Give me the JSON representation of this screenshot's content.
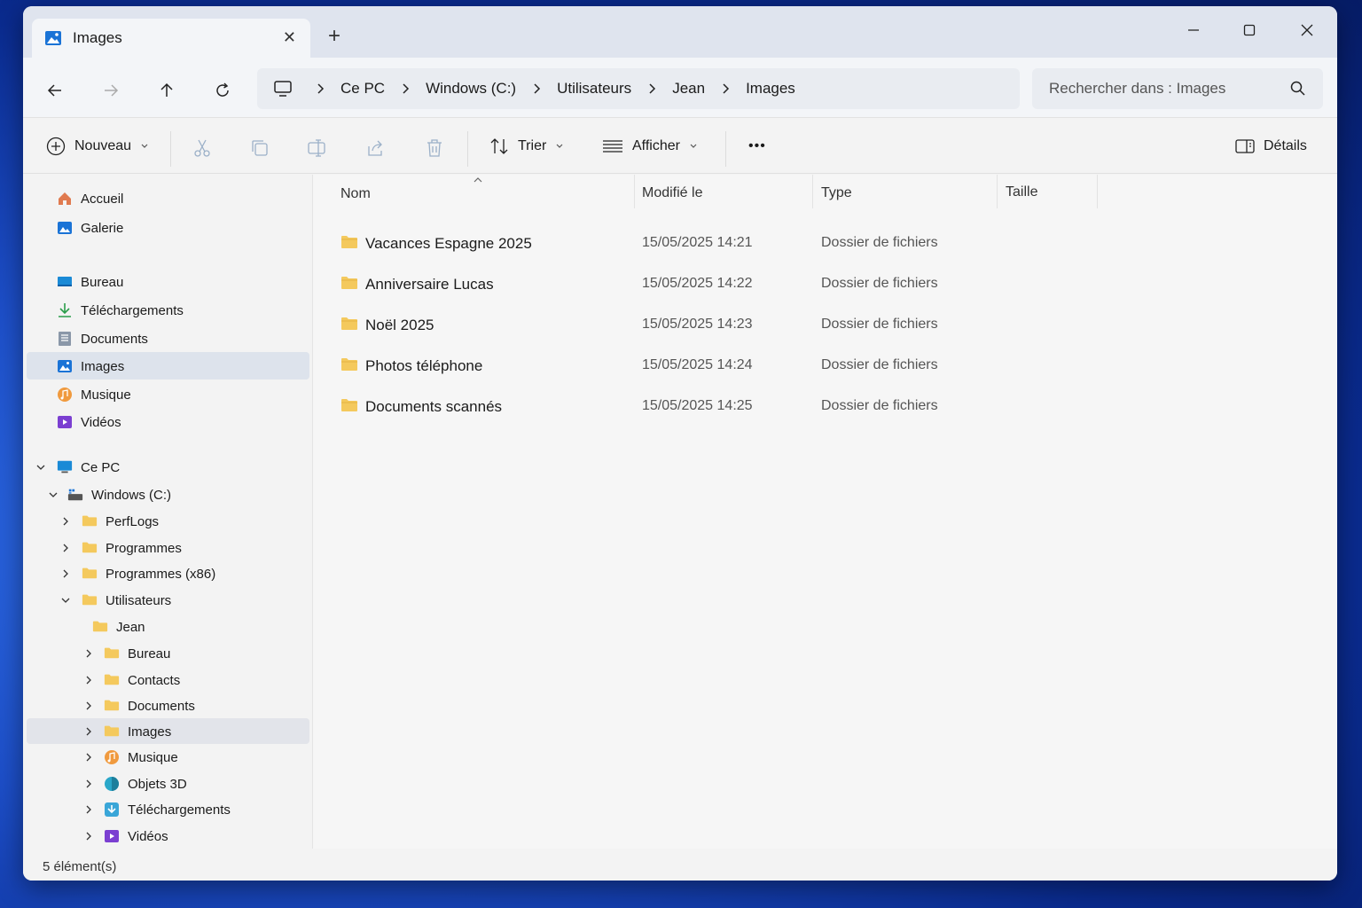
{
  "window": {
    "tab_title": "Images",
    "new_tab_symbol": "+"
  },
  "address": {
    "breadcrumbs": [
      "Ce PC",
      "Windows (C:)",
      "Utilisateurs",
      "Jean",
      "Images"
    ],
    "search_placeholder": "Rechercher dans : Images"
  },
  "toolbar": {
    "new_label": "Nouveau",
    "sort_label": "Trier",
    "view_label": "Afficher",
    "more_label": "•••",
    "details_label": "Détails"
  },
  "sidebar": {
    "quick": [
      {
        "label": "Accueil",
        "icon": "home-icon"
      },
      {
        "label": "Galerie",
        "icon": "gallery-icon"
      }
    ],
    "pinned": [
      {
        "label": "Bureau",
        "icon": "desktop-icon"
      },
      {
        "label": "Téléchargements",
        "icon": "download-icon"
      },
      {
        "label": "Documents",
        "icon": "documents-icon"
      },
      {
        "label": "Images",
        "icon": "pictures-icon"
      },
      {
        "label": "Musique",
        "icon": "music-icon"
      },
      {
        "label": "Vidéos",
        "icon": "videos-icon"
      }
    ],
    "tree": {
      "pc": "Ce PC",
      "drive": "Windows (C:)",
      "drive_children": [
        "PerfLogs",
        "Programmes",
        "Programmes (x86)",
        "Utilisateurs"
      ],
      "user": "Jean",
      "user_children": [
        "Bureau",
        "Contacts",
        "Documents",
        "Images",
        "Musique",
        "Objets 3D",
        "Téléchargements",
        "Vidéos"
      ]
    }
  },
  "content": {
    "columns": {
      "name": "Nom",
      "modified": "Modifié le",
      "type": "Type",
      "size": "Taille"
    },
    "rows": [
      {
        "name": "Vacances Espagne 2025",
        "modified": "15/05/2025 14:21",
        "type": "Dossier de fichiers"
      },
      {
        "name": "Anniversaire Lucas",
        "modified": "15/05/2025 14:22",
        "type": "Dossier de fichiers"
      },
      {
        "name": "Noël 2025",
        "modified": "15/05/2025 14:23",
        "type": "Dossier de fichiers"
      },
      {
        "name": "Photos téléphone",
        "modified": "15/05/2025 14:24",
        "type": "Dossier de fichiers"
      },
      {
        "name": "Documents scannés",
        "modified": "15/05/2025 14:25",
        "type": "Dossier de fichiers"
      }
    ]
  },
  "status": {
    "count": "5 élément(s)"
  },
  "colors": {
    "folder": "#f4c95d",
    "accent": "#1a73d6",
    "selected": "#dde3ec"
  }
}
